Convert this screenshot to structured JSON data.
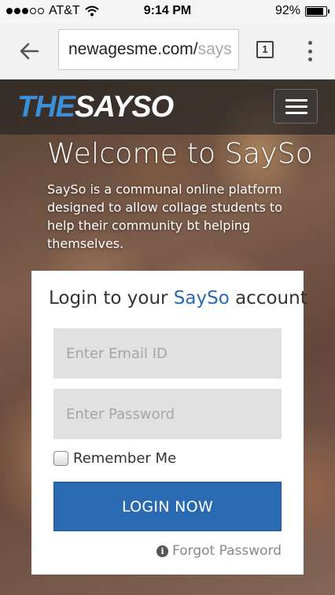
{
  "status_bar": {
    "carrier": "AT&T",
    "time": "9:14 PM",
    "battery": "92%",
    "battery_level": 0.92,
    "signal_bars_filled": 3,
    "signal_bars_total": 5
  },
  "browser": {
    "url_main": "newagesme.com/",
    "url_dim": "says",
    "tab_count": "1",
    "icons": {
      "back": "back-arrow-icon",
      "tabs": "tab-switcher-icon",
      "menu": "overflow-menu-icon"
    }
  },
  "header": {
    "logo_part1": "THE",
    "logo_part2": "SAYSO",
    "menu_icon": "hamburger-icon"
  },
  "hero": {
    "title": "Welcome to SaySo",
    "description": "SaySo is a communal online platform designed to allow collage students to help their community bt helping themselves."
  },
  "login": {
    "heading_prefix": "Login to your ",
    "heading_brand": "SaySo",
    "heading_suffix": " account",
    "email_placeholder": "Enter Email ID",
    "email_value": "",
    "password_placeholder": "Enter Password",
    "password_value": "",
    "remember_label": "Remember Me",
    "remember_checked": false,
    "submit_label": "LOGIN NOW",
    "forgot_label": "Forgot Password",
    "forgot_icon": "info-icon"
  },
  "colors": {
    "accent_blue": "#2a6ab3",
    "logo_blue": "#3b8fd8",
    "input_bg": "#e1e1e1"
  }
}
